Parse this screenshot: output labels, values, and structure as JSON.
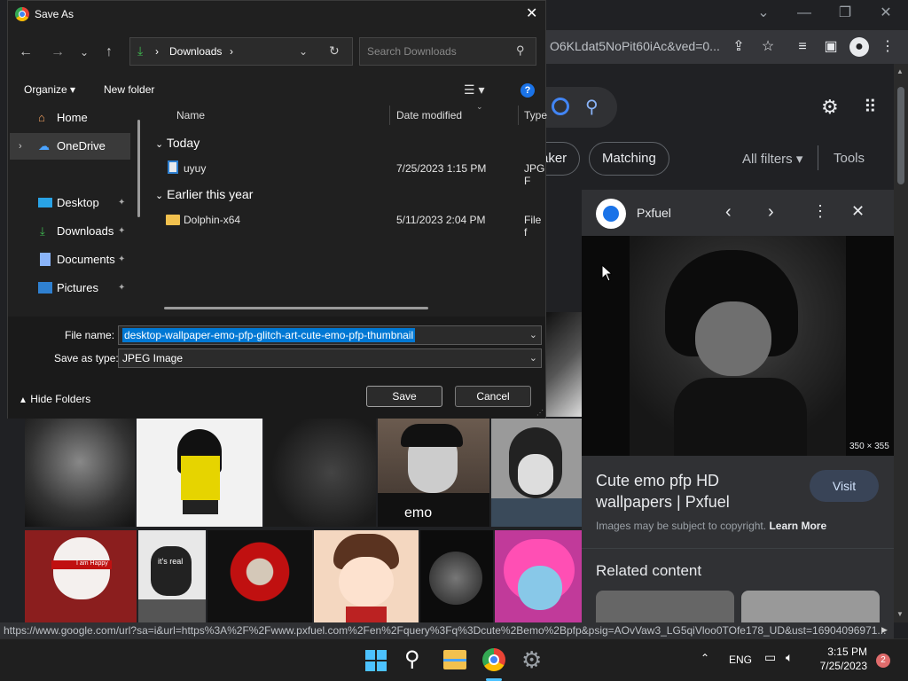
{
  "dialog": {
    "title": "Save As",
    "path_items": [
      "Downloads"
    ],
    "search_placeholder": "Search Downloads",
    "organize_label": "Organize",
    "new_folder_label": "New folder",
    "tree": [
      {
        "label": "Home",
        "pinned": false
      },
      {
        "label": "OneDrive",
        "pinned": false
      },
      {
        "label": "Desktop",
        "pinned": true
      },
      {
        "label": "Downloads",
        "pinned": true
      },
      {
        "label": "Documents",
        "pinned": true
      },
      {
        "label": "Pictures",
        "pinned": true
      }
    ],
    "columns": {
      "name": "Name",
      "date": "Date modified",
      "type": "Type"
    },
    "groups": [
      {
        "label": "Today",
        "files": [
          {
            "name": "uyuy",
            "date": "7/25/2023 1:15 PM",
            "type": "JPG F"
          }
        ]
      },
      {
        "label": "Earlier this year",
        "files": [
          {
            "name": "Dolphin-x64",
            "date": "5/11/2023 2:04 PM",
            "type": "File f"
          }
        ]
      }
    ],
    "file_name_label": "File name:",
    "file_name_value": "desktop-wallpaper-emo-pfp-glitch-art-cute-emo-pfp-thumbnail",
    "save_type_label": "Save as type:",
    "save_type_value": "JPEG Image",
    "hide_folders_label": "Hide Folders",
    "save_label": "Save",
    "cancel_label": "Cancel"
  },
  "browser": {
    "address_text": "O6KLdat5NoPit60iAc&ved=0...",
    "chips": {
      "maker": "aker",
      "matching": "Matching",
      "all_filters": "All filters",
      "tools": "Tools"
    },
    "panel": {
      "source": "Pxfuel",
      "dimensions": "350 × 355",
      "title_line1": "Cute emo pfp HD",
      "title_line2": "wallpapers | Pxfuel",
      "visit_label": "Visit",
      "copyright": "Images may be subject to copyright.",
      "learn_more": "Learn More",
      "related": "Related content"
    },
    "tile_texts": {
      "emo": "emo",
      "its_real": "it's real",
      "happy": "I am Happy"
    },
    "status_url": "https://www.google.com/url?sa=i&url=https%3A%2F%2Fwww.pxfuel.com%2Fen%2Fquery%3Fq%3Dcute%2Bemo%2Bpfp&psig=AOvVaw3_LG5qiVloo0TOfe178_UD&ust=16904096971..."
  },
  "taskbar": {
    "lang": "ENG",
    "time": "3:15 PM",
    "date": "7/25/2023",
    "notifications": "2"
  },
  "colors": {
    "accent": "#1a73e8",
    "selection": "#0078d4",
    "chrome_bg": "#202124"
  }
}
